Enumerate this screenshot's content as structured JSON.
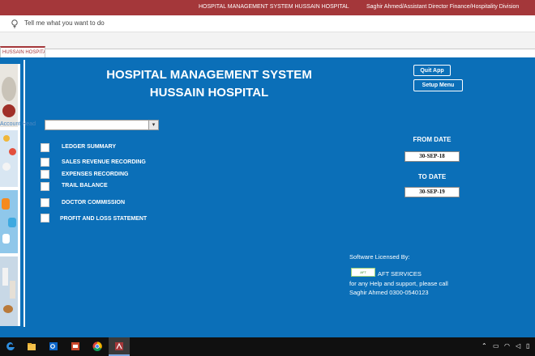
{
  "window": {
    "title": "HOSPITAL MANAGEMENT SYSTEM HUSSAIN HOSPITAL",
    "user": "Saghir Ahmed/Assistant Director Finance/Hospitality Division"
  },
  "tell_me": {
    "placeholder": "Tell me what you want to do"
  },
  "tab": {
    "label": "HUSSAIN HOSPITAL"
  },
  "form": {
    "title_line1": "HOSPITAL MANAGEMENT SYSTEM",
    "title_line2": "HUSSAIN HOSPITAL",
    "quit_label": "Quit App",
    "setup_label": "Setup Menu",
    "account_label": "Account Head",
    "account_value": "",
    "options": [
      {
        "label": "LEDGER SUMMARY",
        "checked": false
      },
      {
        "label": "SALES REVENUE RECORDING",
        "checked": false
      },
      {
        "label": "EXPENSES RECORDING",
        "checked": false
      },
      {
        "label": "TRAIL BALANCE",
        "checked": false
      },
      {
        "label": "DOCTOR COMMISSION",
        "checked": false
      },
      {
        "label": "PROFIT AND LOSS STATEMENT",
        "checked": false
      }
    ],
    "from_date_label": "FROM DATE",
    "from_date_value": "30-SEP-18",
    "to_date_label": "TO DATE",
    "to_date_value": "30-SEP-19",
    "license_heading": "Software Licensed By:",
    "license_company": "AFT SERVICES",
    "license_help": "for any Help and support, please call",
    "license_contact": "Saghir Ahmed 0300-0540123"
  },
  "taskbar": {
    "apps": [
      "edge-icon",
      "file-explorer-icon",
      "outlook-icon",
      "powerpoint-icon",
      "chrome-icon",
      "access-icon"
    ]
  },
  "colors": {
    "titlebar": "#a4373a",
    "form_bg": "#0b6fb8",
    "taskbar": "#101010"
  }
}
